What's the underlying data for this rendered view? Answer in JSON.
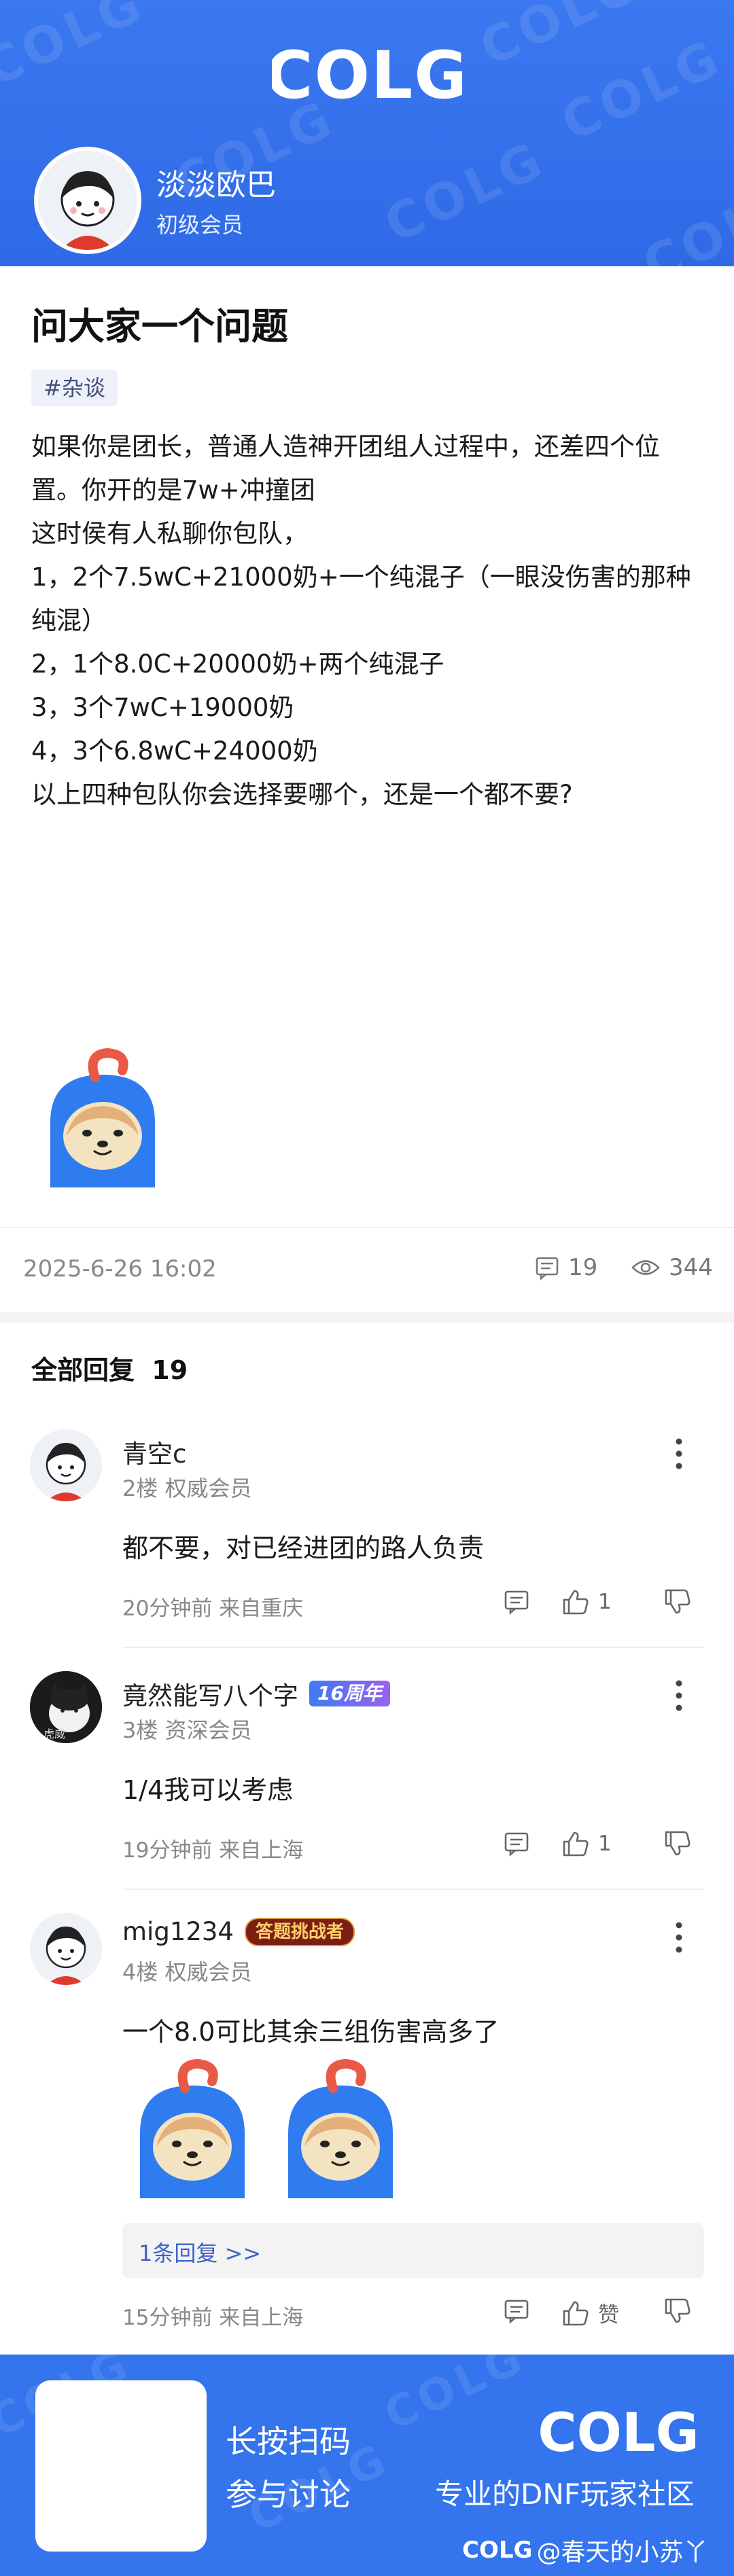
{
  "header": {
    "logo_text": "COLG",
    "watermark_text": "COLG",
    "user_name": "淡淡欧巴",
    "user_level": "初级会员"
  },
  "post": {
    "title": "问大家一个问题",
    "tag": "#杂谈",
    "paragraphs": [
      "如果你是团长，普通人造神开团组人过程中，还差四个位置。你开的是7w+冲撞团",
      "这时侯有人私聊你包队，",
      "",
      "1，2个7.5wC+21000奶+一个纯混子（一眼没伤害的那种纯混）",
      "",
      "2，1个8.0C+20000奶+两个纯混子",
      "",
      "3，3个7wC+19000奶",
      "",
      "4，3个6.8wC+24000奶",
      "",
      "以上四种包队你会选择要哪个，还是一个都不要?"
    ],
    "date": "2025-6-26 16:02",
    "comments_count": "19",
    "views_count": "344"
  },
  "replies_header": {
    "label": "全部回复",
    "count": "19"
  },
  "replies": [
    {
      "name": "青空c",
      "floor_level": "2楼  权威会员",
      "content": "都不要，对已经进团的路人负责",
      "time_loc": "20分钟前  来自重庆",
      "likes": "1"
    },
    {
      "name": "竟然能写八个字",
      "badge": "16周年",
      "floor_level": "3楼  资深会员",
      "content": "1/4我可以考虑",
      "time_loc": "19分钟前  来自上海",
      "likes": "1"
    },
    {
      "name": "mig1234",
      "badge": "答题挑战者",
      "floor_level": "4楼  权威会员",
      "content": "一个8.0可比其余三组伤害高多了",
      "sub_replies": "1条回复 >>",
      "time_loc": "15分钟前  来自上海",
      "likes": "赞"
    }
  ],
  "footer": {
    "scan_line1": "长按扫码",
    "scan_line2": "参与讨论",
    "logo_text": "COLG",
    "slogan": "专业的DNF玩家社区",
    "credit_logo": "COLG",
    "credit_user": "@春天的小苏丫"
  },
  "colors": {
    "brand_blue": "#3474ed",
    "link_blue": "#3e62c7"
  }
}
